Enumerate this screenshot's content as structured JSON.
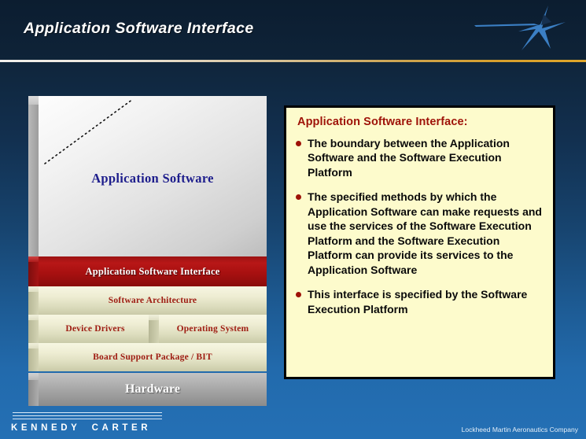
{
  "header": {
    "title": "Application Software Interface",
    "logo_icon": "lockheed-martin-star-icon",
    "rule_start_color": "#f2f0ec",
    "rule_end_color": "#e0a62a"
  },
  "background": {
    "top_color": "#0d1f33",
    "bottom_color": "#2470b5"
  },
  "diagram": {
    "name": "software-layer-stack",
    "layers": [
      {
        "id": "application-software",
        "label": "Application Software",
        "fill": "#e9e9e9",
        "text_color": "#1d1d8c"
      },
      {
        "id": "application-software-interface",
        "label": "Application Software Interface",
        "fill": "#a81010",
        "text_color": "#ffffff"
      },
      {
        "id": "software-architecture",
        "label": "Software Architecture",
        "fill": "#eeedd3",
        "text_color": "#9e1b11"
      },
      {
        "id": "device-drivers",
        "label": "Device Drivers",
        "fill": "#eeedd3",
        "text_color": "#9e1b11"
      },
      {
        "id": "operating-system",
        "label": "Operating System",
        "fill": "#eeedd3",
        "text_color": "#9e1b11"
      },
      {
        "id": "board-support-package-bit",
        "label": "Board Support Package / BIT",
        "fill": "#eeedd3",
        "text_color": "#9e1b11"
      },
      {
        "id": "hardware",
        "label": "Hardware",
        "fill": "#a0a0a0",
        "text_color": "#ffffff"
      }
    ]
  },
  "callout": {
    "heading": "Application Software Interface:",
    "heading_color": "#9e1208",
    "background_color": "#fdfbcc",
    "border_color": "#000000",
    "bullets": [
      "The boundary between the Application Software and the Software Execution Platform",
      "The specified methods by which the Application Software can make requests and use the services of the Software Execution Platform and the Software Execution Platform can provide its services to the Application Software",
      "This interface is specified by the Software Execution Platform"
    ]
  },
  "footer": {
    "brand_part_one": "KENNEDY",
    "brand_part_two": "CARTER",
    "company_note": "Lockheed Martin Aeronautics Company"
  }
}
